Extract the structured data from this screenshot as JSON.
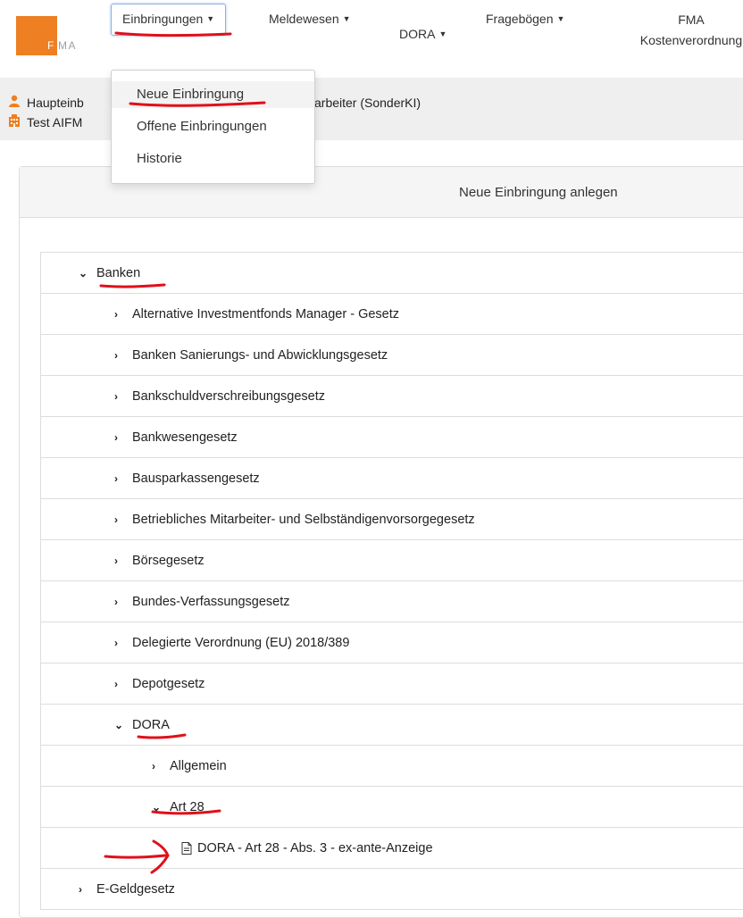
{
  "logo": {
    "letters_white": "F",
    "letters_grey": "MA"
  },
  "nav": {
    "einbringungen": "Einbringungen",
    "meldewesen": "Meldewesen",
    "dora": "DORA",
    "frageboegen": "Fragebögen",
    "fma_line1": "FMA",
    "fma_line2": "Kostenverordnung"
  },
  "user": {
    "line1_start": "Haupteinb",
    "line1_end": "arbeiter (SonderKI)",
    "line2": "Test AIFM"
  },
  "dropdown": {
    "items": [
      "Neue Einbringung",
      "Offene Einbringungen",
      "Historie"
    ]
  },
  "panel": {
    "title": "Neue Einbringung anlegen"
  },
  "tree": {
    "banken": "Banken",
    "items": [
      "Alternative Investmentfonds Manager - Gesetz",
      "Banken Sanierungs- und Abwicklungsgesetz",
      "Bankschuldverschreibungsgesetz",
      "Bankwesengesetz",
      "Bausparkassengesetz",
      "Betriebliches Mitarbeiter- und Selbständigenvorsorgegesetz",
      "Börsegesetz",
      "Bundes-Verfassungsgesetz",
      "Delegierte Verordnung (EU) 2018/389",
      "Depotgesetz"
    ],
    "dora": "DORA",
    "dora_allgemein": "Allgemein",
    "dora_art28": "Art 28",
    "dora_doc": "DORA - Art 28 - Abs. 3 - ex-ante-Anzeige",
    "egeld": "E-Geldgesetz"
  },
  "colors": {
    "brand_orange": "#ee7f22",
    "annotation_red": "#e0101a",
    "highlight_border": "#8cb1e6"
  }
}
